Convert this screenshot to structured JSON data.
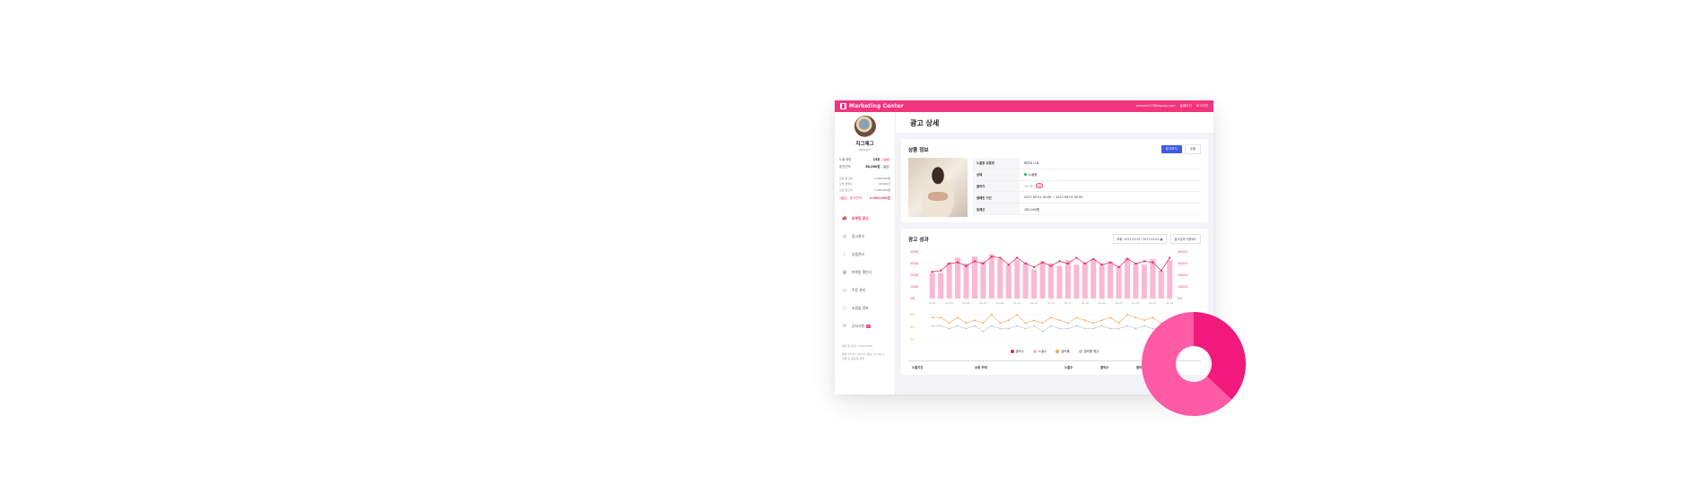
{
  "topbar": {
    "brand": "Marketing Center",
    "links": [
      "sample123@zigzag.com",
      "홈페이지",
      "로그아웃"
    ]
  },
  "sidebar": {
    "store_name": "지그재그",
    "store_id": "zigzag.kr",
    "metrics": [
      {
        "label": "노출 랭킹",
        "value": "15위",
        "button": "상세"
      },
      {
        "label": "충전잔액",
        "value": "30,000원",
        "button": "충전"
      }
    ],
    "stats": [
      {
        "label": "오늘 광고비",
        "value": "1,000,000원"
      },
      {
        "label": "오늘 판매수",
        "value": "40,000건"
      },
      {
        "label": "오늘 광고비",
        "value": "1,000,000원"
      }
    ],
    "charge": {
      "tag": "광고",
      "label": "광고잔액",
      "value": "2,000,000원"
    },
    "nav": [
      {
        "label": "마케팅 광고",
        "icon": "megaphone-icon",
        "glyph": "📣",
        "active": true
      },
      {
        "label": "광고관리",
        "icon": "bid-icon",
        "glyph": "⚖",
        "active": false
      },
      {
        "label": "상품관리",
        "icon": "chart-icon",
        "glyph": "⌇",
        "active": false
      },
      {
        "label": "마케팅 캘린더",
        "icon": "calendar-icon",
        "glyph": "▦",
        "active": false
      },
      {
        "label": "주문 관리",
        "icon": "cart-icon",
        "glyph": "⊔",
        "active": false
      },
      {
        "label": "쇼핑몰 정보",
        "icon": "info-icon",
        "glyph": "ⓘ",
        "active": false
      },
      {
        "label": "공지사항",
        "icon": "notice-icon",
        "glyph": "✉",
        "active": false,
        "badge": "N"
      }
    ],
    "footer": [
      "제휴 및 문의: 1670-4845",
      "평일 10:00~18:00 (점심 12:30~)",
      "주말 및 공휴일 휴무"
    ]
  },
  "main": {
    "page_title": "광고 상세",
    "product_card": {
      "title": "상품 정보",
      "primary_button": "광고하기",
      "secondary_button": "수정",
      "rows": [
        {
          "key": "노출용 상품명",
          "value": "화이트 니트"
        },
        {
          "key": "상태",
          "value": "노출중"
        },
        {
          "key": "클릭가",
          "value": "100원",
          "tag": "변경"
        },
        {
          "key": "캠페인 기간",
          "value": "2017.09.01 00:00 ~ 2017.09.01 00:00"
        },
        {
          "key": "일예산",
          "value": "100,000원"
        }
      ]
    },
    "perf_card": {
      "title": "광고 성과",
      "date_range": "조회: 2017.01.01~2017.01.01",
      "download": "광고성과 다운로드",
      "legend": [
        {
          "label": "클릭수",
          "color": "#e0245e"
        },
        {
          "label": "노출수",
          "color": "#f8b4d3"
        },
        {
          "label": "클릭률",
          "color": "#f5a356"
        },
        {
          "label": "클릭률 평균",
          "color": "#b9c7d8"
        }
      ],
      "table_headers": [
        "노출기간",
        "쇼핑 카테",
        "노출수",
        "클릭수",
        "클릭률"
      ]
    }
  },
  "chart_data": {
    "type": "bar",
    "title": "",
    "x": [
      "01.01",
      "01.02",
      "01.03",
      "01.04",
      "01.05",
      "01.06",
      "01.07",
      "01.08",
      "01.09",
      "01.10",
      "01.11",
      "01.12",
      "01.13",
      "01.14",
      "01.15",
      "01.16",
      "01.17",
      "01.18",
      "01.19",
      "01.20",
      "01.21",
      "01.22",
      "01.23",
      "01.24",
      "01.25",
      "01.26",
      "01.27",
      "01.28",
      "01.29"
    ],
    "y_left_ticks": [
      "400회",
      "300회",
      "200회",
      "100회",
      "0회"
    ],
    "y_right_ticks": [
      "4000%",
      "3000%",
      "2000%",
      "1000%",
      "0%"
    ],
    "ylim": [
      0,
      400
    ],
    "series": [
      {
        "name": "노출수",
        "type": "bar",
        "values": [
          220,
          220,
          310,
          350,
          300,
          360,
          320,
          380,
          340,
          290,
          330,
          310,
          250,
          320,
          300,
          280,
          330,
          290,
          310,
          340,
          300,
          320,
          280,
          350,
          300,
          290,
          340,
          240,
          330
        ]
      },
      {
        "name": "클릭수",
        "type": "line",
        "values": [
          230,
          240,
          300,
          310,
          280,
          320,
          300,
          360,
          350,
          290,
          350,
          300,
          270,
          310,
          280,
          320,
          300,
          350,
          300,
          340,
          290,
          310,
          270,
          340,
          300,
          320,
          310,
          240,
          350
        ]
      },
      {
        "name": "클릭률",
        "type": "line",
        "values": [
          6,
          6,
          5,
          6,
          5,
          5.5,
          5,
          6.5,
          5,
          5.5,
          6.5,
          5,
          5.5,
          5,
          6,
          5.5,
          5,
          6,
          5.5,
          5,
          5.5,
          6,
          5,
          6.5,
          6,
          5.5,
          6,
          5,
          5.5
        ]
      },
      {
        "name": "클릭률 평균",
        "type": "line",
        "values": [
          4.5,
          4.5,
          4,
          4.5,
          4,
          4.5,
          3.5,
          4.5,
          4,
          4,
          4.5,
          4,
          4.5,
          3.5,
          4.5,
          4,
          4,
          4.5,
          4,
          4,
          4.5,
          4,
          4,
          4.5,
          4,
          4.5,
          4,
          4,
          4.5
        ]
      }
    ],
    "y2_ticks": [
      "6%",
      "4%",
      "2%"
    ]
  },
  "donut": {
    "type": "pie",
    "values": [
      37,
      63
    ],
    "colors": [
      "#f2197d",
      "#fe5aa6"
    ]
  }
}
